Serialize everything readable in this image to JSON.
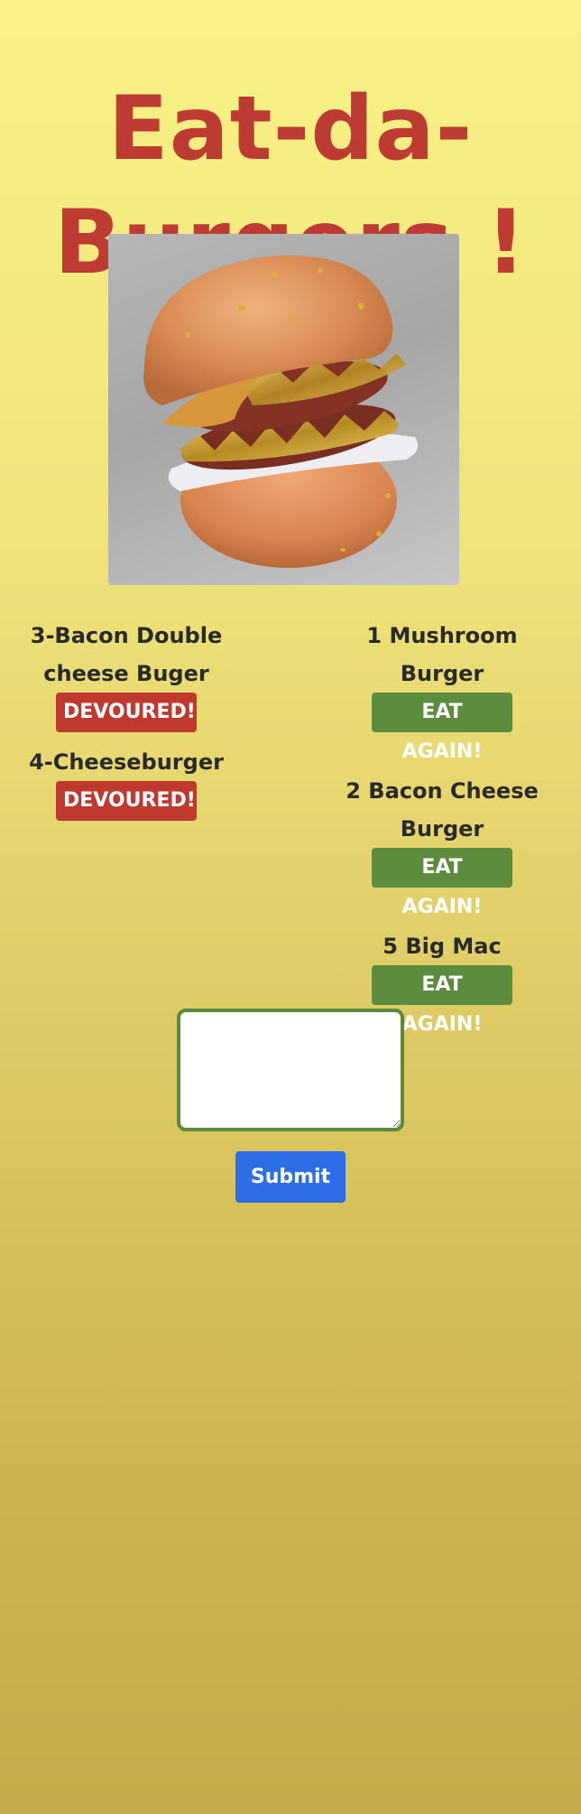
{
  "header": {
    "title_line1": "Eat-da-",
    "title_line2": "Burgers !"
  },
  "hero": {
    "icon": "burger-image"
  },
  "devoured": {
    "items": [
      {
        "name": "3-Bacon Double cheese Buger",
        "button": "DEVOURED!"
      },
      {
        "name": "4-Cheeseburger",
        "button": "DEVOURED!"
      }
    ]
  },
  "to_eat": {
    "items": [
      {
        "name": "1 Mushroom Burger",
        "button": "EAT AGAIN!"
      },
      {
        "name": "2 Bacon Cheese Burger",
        "button": "EAT AGAIN!"
      },
      {
        "name": "5 Big Mac",
        "button": "EAT AGAIN!"
      }
    ]
  },
  "form": {
    "textarea_value": "",
    "submit_label": "Submit"
  },
  "colors": {
    "title": "#bd3b33",
    "devoured_button": "#c0392f",
    "eat_again_button": "#5e8c3f",
    "submit_button": "#2e6de8",
    "textarea_border": "#5a8a3c"
  }
}
